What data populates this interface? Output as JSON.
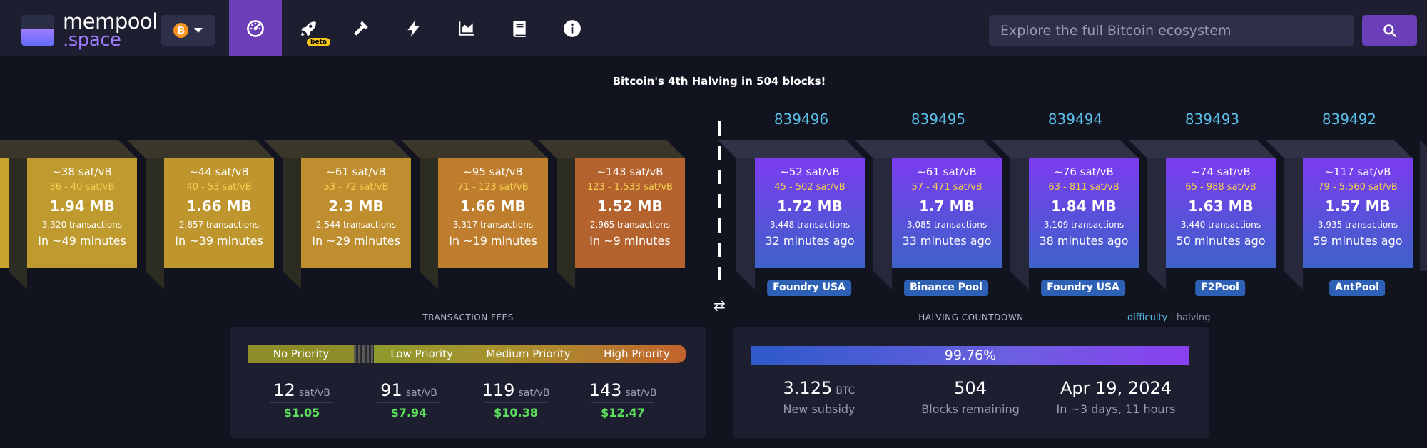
{
  "nav": {
    "logo_line1": "mempool",
    "logo_line2": ".space",
    "beta_label": "beta",
    "items": [
      "dashboard-icon",
      "rocket-icon",
      "hammer-icon",
      "lightning-icon",
      "chart-icon",
      "book-icon",
      "info-icon"
    ],
    "search_placeholder": "Explore the full Bitcoin ecosystem",
    "network_symbol": "₿"
  },
  "halving_title": "Bitcoin's 4th Halving in 504 blocks!",
  "mempool_blocks": [
    {
      "fee": "~38 sat/vB",
      "range": "36 - 40 sat/vB",
      "size": "1.94 MB",
      "txs": "3,320 transactions",
      "time": "In ~49 minutes"
    },
    {
      "fee": "~44 sat/vB",
      "range": "40 - 53 sat/vB",
      "size": "1.66 MB",
      "txs": "2,857 transactions",
      "time": "In ~39 minutes"
    },
    {
      "fee": "~61 sat/vB",
      "range": "53 - 72 sat/vB",
      "size": "2.3 MB",
      "txs": "2,544 transactions",
      "time": "In ~29 minutes"
    },
    {
      "fee": "~95 sat/vB",
      "range": "71 - 123 sat/vB",
      "size": "1.66 MB",
      "txs": "3,317 transactions",
      "time": "In ~19 minutes"
    },
    {
      "fee": "~143 sat/vB",
      "range": "123 - 1,533 sat/vB",
      "size": "1.52 MB",
      "txs": "2,965 transactions",
      "time": "In ~9 minutes"
    }
  ],
  "mined_blocks": [
    {
      "height": "839496",
      "fee": "~52 sat/vB",
      "range": "45 - 502 sat/vB",
      "size": "1.72 MB",
      "txs": "3,448 transactions",
      "time": "32 minutes ago",
      "pool": "Foundry USA"
    },
    {
      "height": "839495",
      "fee": "~61 sat/vB",
      "range": "57 - 471 sat/vB",
      "size": "1.7 MB",
      "txs": "3,085 transactions",
      "time": "33 minutes ago",
      "pool": "Binance Pool"
    },
    {
      "height": "839494",
      "fee": "~76 sat/vB",
      "range": "63 - 811 sat/vB",
      "size": "1.84 MB",
      "txs": "3,109 transactions",
      "time": "38 minutes ago",
      "pool": "Foundry USA"
    },
    {
      "height": "839493",
      "fee": "~74 sat/vB",
      "range": "65 - 988 sat/vB",
      "size": "1.63 MB",
      "txs": "3,440 transactions",
      "time": "50 minutes ago",
      "pool": "F2Pool"
    },
    {
      "height": "839492",
      "fee": "~117 sat/vB",
      "range": "79 - 5,560 sat/vB",
      "size": "1.57 MB",
      "txs": "3,935 transactions",
      "time": "59 minutes ago",
      "pool": "AntPool"
    }
  ],
  "fees": {
    "title": "TRANSACTION FEES",
    "labels": [
      "No Priority",
      "Low Priority",
      "Medium Priority",
      "High Priority"
    ],
    "values": [
      {
        "n": "12",
        "unit": "sat/vB",
        "usd": "$1.05"
      },
      {
        "n": "91",
        "unit": "sat/vB",
        "usd": "$7.94"
      },
      {
        "n": "119",
        "unit": "sat/vB",
        "usd": "$10.38"
      },
      {
        "n": "143",
        "unit": "sat/vB",
        "usd": "$12.47"
      }
    ]
  },
  "halving": {
    "title": "HALVING COUNTDOWN",
    "toggle_a": "difficulty",
    "toggle_sep": "|",
    "toggle_b": "halving",
    "progress": "99.76%",
    "subsidy_value": "3.125",
    "subsidy_unit": "BTC",
    "subsidy_label": "New subsidy",
    "blocks_value": "504",
    "blocks_label": "Blocks remaining",
    "date_value": "Apr 19, 2024",
    "date_label": "In ~3 days, 11 hours"
  },
  "colors": {
    "accent": "#6b3fb8",
    "height_link": "#5ac0e7",
    "usd_green": "#5cdf5a",
    "fee_range": "#f5d04e",
    "pool_tag": "#2e61b5"
  }
}
